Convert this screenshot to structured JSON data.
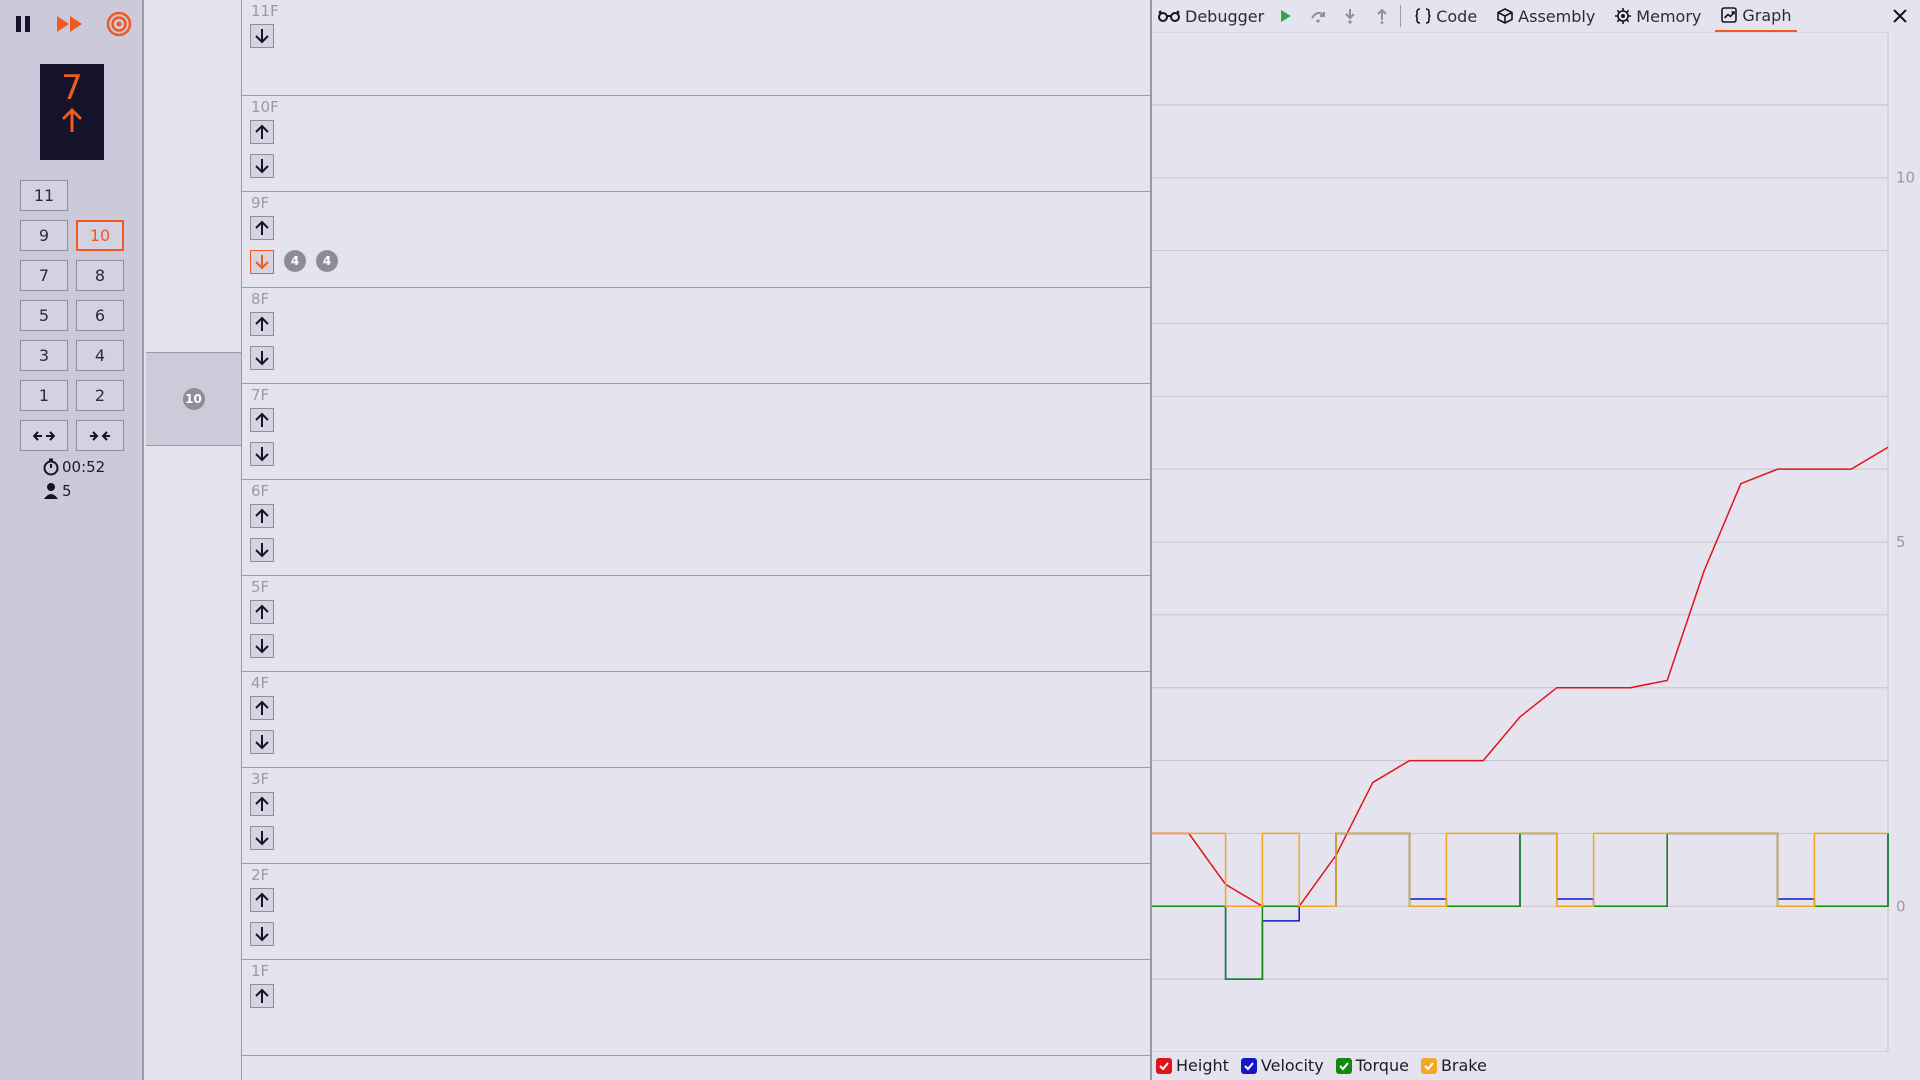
{
  "controls": {
    "pause_icon": "pause-icon",
    "fast_forward_icon": "fast-forward-icon",
    "target_icon": "target-icon",
    "accent": "#f05a1e"
  },
  "display": {
    "floor": "7",
    "direction_icon": "arrow-up-icon"
  },
  "cab_buttons": [
    {
      "label": "11",
      "active": false
    },
    {
      "label": "9",
      "active": false
    },
    {
      "label": "10",
      "active": true
    },
    {
      "label": "7",
      "active": false
    },
    {
      "label": "8",
      "active": false
    },
    {
      "label": "5",
      "active": false
    },
    {
      "label": "6",
      "active": false
    },
    {
      "label": "3",
      "active": false
    },
    {
      "label": "4",
      "active": false
    },
    {
      "label": "1",
      "active": false
    },
    {
      "label": "2",
      "active": false
    }
  ],
  "door_buttons": {
    "open_icon": "door-open-icon",
    "close_icon": "door-close-icon"
  },
  "status": {
    "time": "00:52",
    "passengers": "5"
  },
  "car": {
    "occupants": "10"
  },
  "floors": [
    {
      "label": "11F",
      "up": false,
      "down": true,
      "down_active": false,
      "waiting": []
    },
    {
      "label": "10F",
      "up": true,
      "down": true,
      "down_active": false,
      "waiting": []
    },
    {
      "label": "9F",
      "up": true,
      "down": true,
      "down_active": true,
      "waiting": [
        "4",
        "4"
      ]
    },
    {
      "label": "8F",
      "up": true,
      "down": true,
      "down_active": false,
      "waiting": []
    },
    {
      "label": "7F",
      "up": true,
      "down": true,
      "down_active": false,
      "waiting": []
    },
    {
      "label": "6F",
      "up": true,
      "down": true,
      "down_active": false,
      "waiting": []
    },
    {
      "label": "5F",
      "up": true,
      "down": true,
      "down_active": false,
      "waiting": []
    },
    {
      "label": "4F",
      "up": true,
      "down": true,
      "down_active": false,
      "waiting": []
    },
    {
      "label": "3F",
      "up": true,
      "down": true,
      "down_active": false,
      "waiting": []
    },
    {
      "label": "2F",
      "up": true,
      "down": true,
      "down_active": false,
      "waiting": []
    },
    {
      "label": "1F",
      "up": true,
      "down": false,
      "down_active": false,
      "waiting": []
    }
  ],
  "debugger": {
    "title": "Debugger",
    "tabs": [
      {
        "label": "Code",
        "icon": "braces-icon",
        "active": false
      },
      {
        "label": "Assembly",
        "icon": "cube-icon",
        "active": false
      },
      {
        "label": "Memory",
        "icon": "chip-icon",
        "active": false
      },
      {
        "label": "Graph",
        "icon": "chart-icon",
        "active": true
      }
    ]
  },
  "chart_data": {
    "type": "line",
    "title": "",
    "xlabel": "",
    "ylabel": "",
    "ylim": [
      -2,
      12
    ],
    "yticks": [
      "0",
      "5",
      "10"
    ],
    "x": [
      0,
      5,
      10,
      15,
      20,
      25,
      30,
      35,
      40,
      45,
      50,
      55,
      60,
      65,
      70,
      75,
      80,
      85,
      90,
      95,
      100
    ],
    "series": [
      {
        "name": "Height",
        "color": "#e0131b",
        "visible": true,
        "values": [
          1.0,
          1.0,
          0.3,
          0.0,
          0.0,
          0.7,
          1.7,
          2.0,
          2.0,
          2.0,
          2.6,
          3.0,
          3.0,
          3.0,
          3.1,
          4.6,
          5.8,
          6.0,
          6.0,
          6.0,
          6.3
        ]
      },
      {
        "name": "Velocity",
        "color": "#1616c8",
        "visible": true,
        "values": [
          0.0,
          0.0,
          -1.0,
          -0.2,
          0.0,
          1.0,
          1.0,
          0.1,
          0.0,
          0.0,
          1.0,
          0.1,
          0.0,
          0.0,
          1.0,
          1.0,
          1.0,
          0.1,
          0.0,
          0.0,
          1.0
        ]
      },
      {
        "name": "Torque",
        "color": "#128a12",
        "visible": true,
        "values": [
          0.0,
          0.0,
          -1.0,
          0.0,
          0.0,
          1.0,
          1.0,
          0.0,
          0.0,
          0.0,
          1.0,
          0.0,
          0.0,
          0.0,
          1.0,
          1.0,
          1.0,
          0.0,
          0.0,
          0.0,
          1.0
        ]
      },
      {
        "name": "Brake",
        "color": "#f5a623",
        "visible": true,
        "values": [
          1.0,
          1.0,
          0.0,
          1.0,
          0.0,
          1.0,
          1.0,
          0.0,
          1.0,
          1.0,
          1.0,
          0.0,
          1.0,
          1.0,
          1.0,
          1.0,
          1.0,
          0.0,
          1.0,
          1.0,
          1.0
        ]
      }
    ],
    "grid": true,
    "legend": "bottom-left"
  }
}
